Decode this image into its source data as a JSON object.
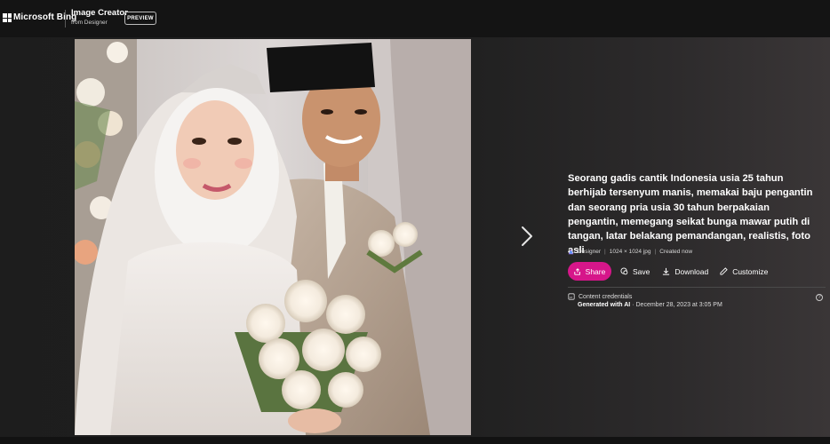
{
  "header": {
    "brand": "Microsoft Bing",
    "product_title": "Image Creator",
    "product_subtitle": "from Designer",
    "badge": "PREVIEW"
  },
  "image": {
    "alt_description": ""
  },
  "prompt": "Seorang gadis cantik Indonesia usia 25 tahun berhijab tersenyum manis, memakai baju pengantin dan seorang pria usia 30 tahun berpakaian pengantin, memegang seikat bunga mawar putih di tangan, latar belakang pemandangan, realistis, foto asli",
  "meta": {
    "source": "Designer",
    "resolution": "1024 × 1024 jpg",
    "created": "Created now"
  },
  "actions": {
    "share": "Share",
    "save": "Save",
    "download": "Download",
    "customize": "Customize"
  },
  "credentials": {
    "title": "Content credentials",
    "generated": "Generated with AI",
    "date": "December 28, 2023 at 3:05 PM"
  },
  "colors": {
    "accent": "#d6168a",
    "background": "#1c1c1c",
    "header": "#141414"
  },
  "icons": {
    "logo": "microsoft-logo-icon",
    "next": "chevron-right-icon",
    "designer": "designer-icon",
    "share": "share-icon",
    "save": "save-icon",
    "download": "download-icon",
    "customize": "customize-icon",
    "credentials": "content-credentials-icon",
    "help": "help-icon"
  }
}
